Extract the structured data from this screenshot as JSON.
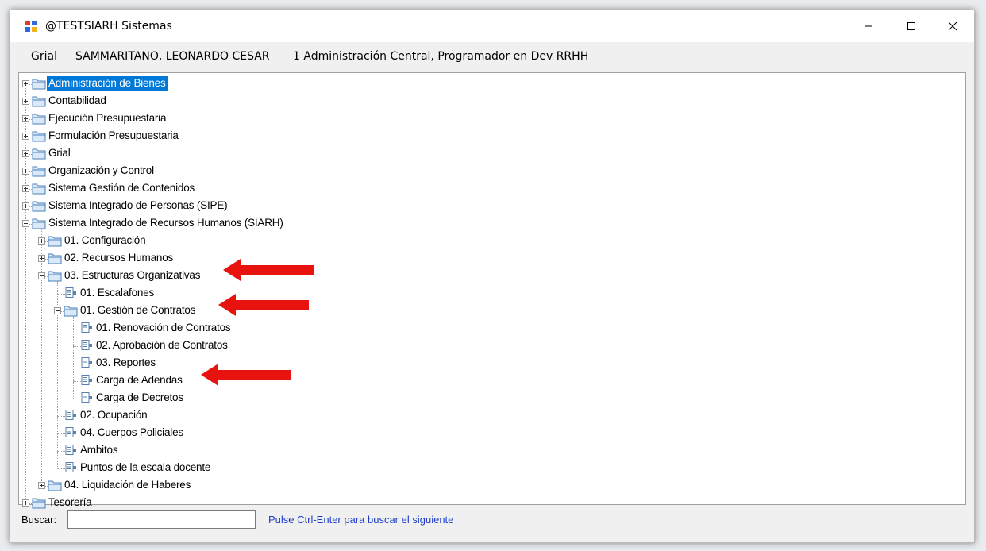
{
  "window": {
    "title": "@TESTSIARH Sistemas",
    "minimize_glyph": "minimize-icon",
    "maximize_glyph": "maximize-icon",
    "close_glyph": "close-icon"
  },
  "menubar": {
    "app": "Grial",
    "user": "SAMMARITANO, LEONARDO CESAR",
    "context": "1 Administración Central, Programador en Dev RRHH"
  },
  "tree": {
    "nodes": [
      {
        "label": "Administración de Bienes",
        "type": "folder",
        "level": 0,
        "state": "collapsed",
        "selected": true
      },
      {
        "label": "Contabilidad",
        "type": "folder",
        "level": 0,
        "state": "collapsed"
      },
      {
        "label": "Ejecución Presupuestaria",
        "type": "folder",
        "level": 0,
        "state": "collapsed"
      },
      {
        "label": "Formulación Presupuestaria",
        "type": "folder",
        "level": 0,
        "state": "collapsed"
      },
      {
        "label": "Grial",
        "type": "folder",
        "level": 0,
        "state": "collapsed"
      },
      {
        "label": "Organización y Control",
        "type": "folder",
        "level": 0,
        "state": "collapsed"
      },
      {
        "label": "Sistema Gestión de Contenidos",
        "type": "folder",
        "level": 0,
        "state": "collapsed"
      },
      {
        "label": "Sistema Integrado de Personas (SIPE)",
        "type": "folder",
        "level": 0,
        "state": "collapsed"
      },
      {
        "label": "Sistema Integrado de Recursos Humanos (SIARH)",
        "type": "folder",
        "level": 0,
        "state": "expanded"
      },
      {
        "label": "01. Configuración",
        "type": "folder",
        "level": 1,
        "state": "collapsed"
      },
      {
        "label": "02. Recursos Humanos",
        "type": "folder",
        "level": 1,
        "state": "collapsed"
      },
      {
        "label": "03. Estructuras Organizativas",
        "type": "folder",
        "level": 1,
        "state": "expanded",
        "highlighted": true
      },
      {
        "label": "01. Escalafones",
        "type": "form",
        "level": 2
      },
      {
        "label": "01. Gestión de Contratos",
        "type": "folder",
        "level": 2,
        "state": "expanded",
        "highlighted": true
      },
      {
        "label": "01. Renovación de Contratos",
        "type": "form",
        "level": 3
      },
      {
        "label": "02. Aprobación de Contratos",
        "type": "form",
        "level": 3
      },
      {
        "label": "03. Reportes",
        "type": "form",
        "level": 3
      },
      {
        "label": "Carga de Adendas",
        "type": "form",
        "level": 3,
        "highlighted": true
      },
      {
        "label": "Carga de Decretos",
        "type": "form",
        "level": 3
      },
      {
        "label": "02. Ocupación",
        "type": "form",
        "level": 2
      },
      {
        "label": "04. Cuerpos Policiales",
        "type": "form",
        "level": 2
      },
      {
        "label": "Ambitos",
        "type": "form",
        "level": 2
      },
      {
        "label": "Puntos de la escala docente",
        "type": "form",
        "level": 2
      },
      {
        "label": "04. Liquidación de Haberes",
        "type": "folder",
        "level": 1,
        "state": "collapsed"
      },
      {
        "label": "Tesorería",
        "type": "folder",
        "level": 0,
        "state": "collapsed"
      }
    ]
  },
  "search": {
    "label": "Buscar:",
    "value": "",
    "hint": "Pulse Ctrl-Enter para buscar el siguiente"
  },
  "colors": {
    "selection": "#0078d7",
    "annotation_arrow": "#e8130f",
    "hint_text": "#1f3fc9"
  }
}
